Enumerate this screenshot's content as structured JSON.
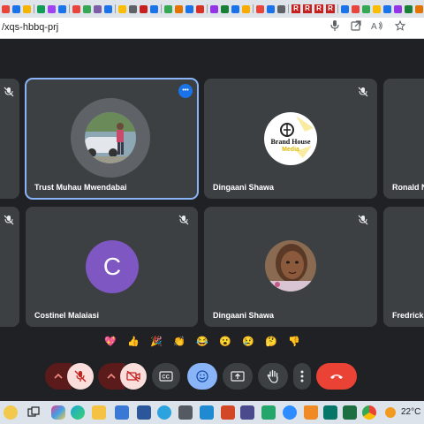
{
  "browser": {
    "url": "/xqs-hbbq-prj",
    "tab_labels": [
      "R",
      "R",
      "R",
      "R"
    ]
  },
  "meeting": {
    "participants": [
      {
        "name": "Trust Muhau Mwendabai",
        "active": true,
        "muted": false
      },
      {
        "name": "Dingaani Shawa",
        "active": false,
        "muted": true
      },
      {
        "name": "Ronald N",
        "active": false,
        "muted": false
      },
      {
        "name": "Costinel Malaiasi",
        "active": false,
        "muted": true,
        "initial": "C"
      },
      {
        "name": "Dingaani Shawa",
        "active": false,
        "muted": true
      },
      {
        "name": "Fredrick",
        "active": false,
        "muted": false
      }
    ],
    "brand_logo": {
      "line1": "Brand House",
      "line2": "Media"
    },
    "more_options_label": "•••"
  },
  "reactions": [
    "💖",
    "👍",
    "🎉",
    "👏",
    "😂",
    "😮",
    "😢",
    "🤔",
    "👎"
  ],
  "controls": [
    "mic-options",
    "mic",
    "camera-options",
    "camera",
    "captions",
    "emoji",
    "present",
    "raise-hand",
    "more",
    "leave-call"
  ],
  "taskbar": {
    "temperature": "22°C",
    "apps": [
      "files",
      "copilot",
      "edge",
      "explorer",
      "store",
      "word",
      "telegram",
      "calculator",
      "vscode",
      "powerpoint",
      "jw",
      "vsc2",
      "zoom",
      "vlc",
      "publisher",
      "excel",
      "chrome"
    ]
  },
  "colors": {
    "accent": "#8ab4f8",
    "leave": "#ea4335",
    "muted_bg": "#5c1b1b",
    "tile_bg": "#3c4043",
    "stage_bg": "#202124"
  }
}
